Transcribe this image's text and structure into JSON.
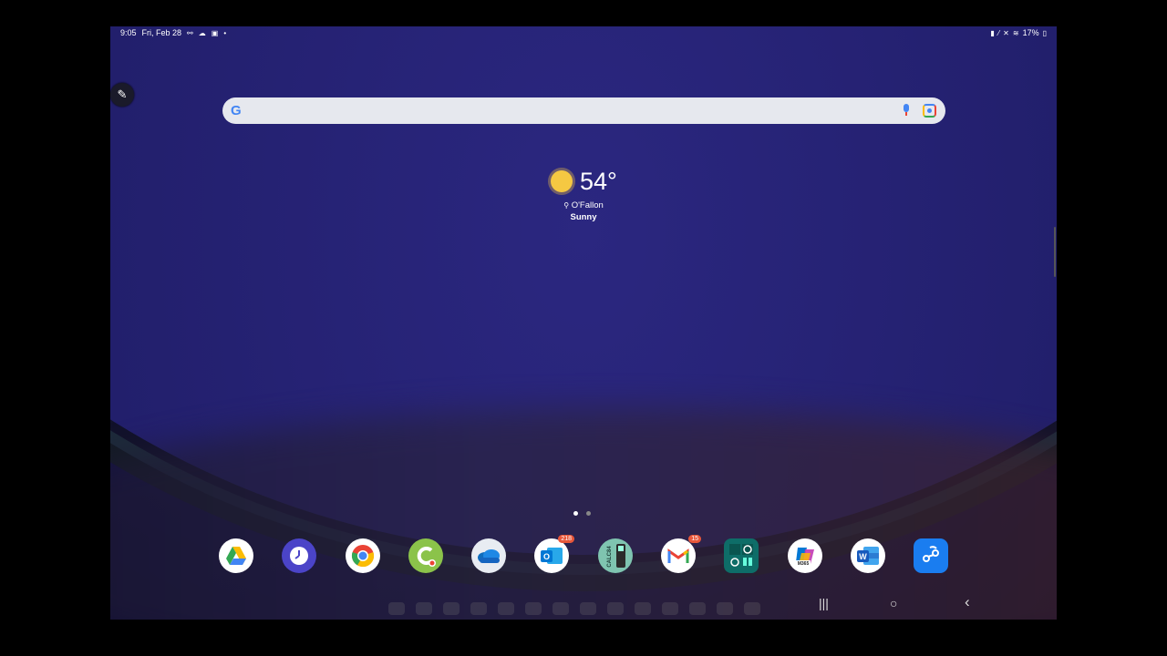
{
  "status_bar": {
    "time": "9:05",
    "date": "Fri, Feb 28",
    "notification_icons": [
      "link-icon",
      "cloud-icon",
      "image-icon",
      "dot-icon"
    ],
    "system_icons": [
      "battery-saver-icon",
      "vibrate-icon",
      "mute-icon",
      "wifi-icon"
    ],
    "battery": "17%"
  },
  "search_bar": {
    "logo": "G"
  },
  "weather": {
    "temperature": "54°",
    "location": "O'Fallon",
    "condition": "Sunny"
  },
  "page_indicator": {
    "pages": 2,
    "current": 1
  },
  "dock": {
    "apps": [
      {
        "name": "Drive",
        "icon": "google-drive-icon",
        "badge": ""
      },
      {
        "name": "Clock",
        "icon": "clock-icon",
        "badge": ""
      },
      {
        "name": "Chrome",
        "icon": "chrome-icon",
        "badge": ""
      },
      {
        "name": "C",
        "icon": "c-app-icon",
        "badge": ""
      },
      {
        "name": "OneDrive",
        "icon": "onedrive-icon",
        "badge": ""
      },
      {
        "name": "Outlook",
        "icon": "outlook-icon",
        "badge": "218"
      },
      {
        "name": "CALC84",
        "icon": "calculator-icon",
        "badge": ""
      },
      {
        "name": "Gmail",
        "icon": "gmail-icon",
        "badge": "15"
      },
      {
        "name": "Tools",
        "icon": "tools-icon",
        "badge": ""
      },
      {
        "name": "M365",
        "icon": "m365-icon",
        "badge": ""
      },
      {
        "name": "Word",
        "icon": "word-icon",
        "badge": ""
      },
      {
        "name": "Link",
        "icon": "link-app-icon",
        "badge": ""
      }
    ]
  },
  "nav_bar": {
    "recents": "|||",
    "home": "○",
    "back": "‹"
  },
  "colors": {
    "wallpaper": "#1c1f6e",
    "search_bg": "#e6e8ee",
    "badge": "#e8573a",
    "sun": "#f5c842"
  }
}
